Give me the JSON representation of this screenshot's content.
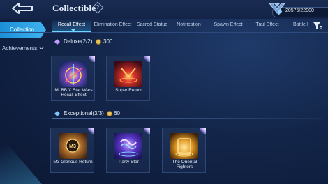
{
  "header": {
    "title": "Collectible",
    "help_symbol": "?",
    "currency_amount": "20575/22000"
  },
  "sidebar": {
    "items": [
      {
        "label": "Collection",
        "active": true
      },
      {
        "label": "Achievements"
      }
    ]
  },
  "tabs": [
    {
      "label": "Recall Effect",
      "active": true
    },
    {
      "label": "Elimination Effect"
    },
    {
      "label": "Sacred Statue"
    },
    {
      "label": "Notification"
    },
    {
      "label": "Spawn Effect"
    },
    {
      "label": "Trail Effect"
    },
    {
      "label": "Battle I"
    }
  ],
  "sections": [
    {
      "label": "Deluxe(2/2)",
      "count": "300",
      "items": [
        {
          "name": "MLBB X Star Wars Recall Effect"
        },
        {
          "name": "Super Return"
        }
      ]
    },
    {
      "label": "Exceptional(3/3)",
      "count": "60",
      "items": [
        {
          "name": "M3 Glorious Return",
          "badge": "M3"
        },
        {
          "name": "Party Star"
        },
        {
          "name": "The Oriental Fighters"
        }
      ]
    }
  ],
  "colors": {
    "accent": "#3fb3f0",
    "active_tab_underline": "#6fd6ff",
    "coin": "#e6c25a",
    "background": "#13264a"
  },
  "icons": [
    "back-arrow-icon",
    "help-icon",
    "rank-emblem-icon",
    "gem-icon",
    "filter-icon",
    "chevron-down-icon",
    "diamond-icon",
    "coin-icon"
  ]
}
